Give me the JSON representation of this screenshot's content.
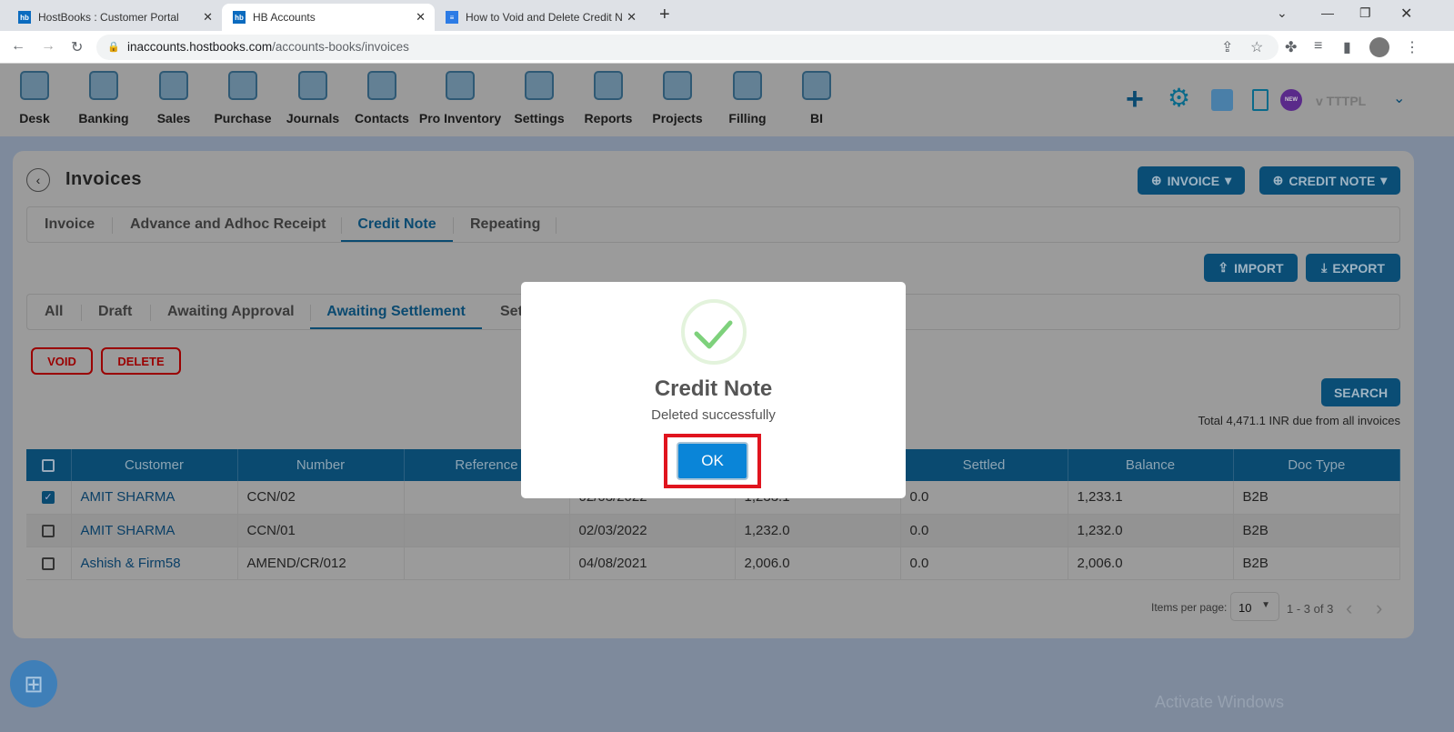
{
  "browser": {
    "tabs": [
      {
        "label": "HostBooks : Customer Portal",
        "favicon": "hb"
      },
      {
        "label": "HB Accounts",
        "favicon": "hb",
        "active": true
      },
      {
        "label": "How to Void and Delete Credit N",
        "favicon": "doc"
      }
    ],
    "url_host": "inaccounts.hostbooks.com",
    "url_path": "/accounts-books/invoices"
  },
  "nav": {
    "items": [
      "Desk",
      "Banking",
      "Sales",
      "Purchase",
      "Journals",
      "Contacts",
      "Pro Inventory",
      "Settings",
      "Reports",
      "Projects",
      "Filling",
      "BI"
    ],
    "company": "v TTTPL",
    "new_badge": "NEW"
  },
  "page": {
    "title": "Invoices",
    "invoice_btn": "INVOICE",
    "credit_note_btn": "CREDIT NOTE",
    "tabs": [
      "Invoice",
      "Advance and Adhoc Receipt",
      "Credit Note",
      "Repeating"
    ],
    "import": "IMPORT",
    "export": "EXPORT",
    "status_tabs": [
      "All",
      "Draft",
      "Awaiting Approval",
      "Awaiting Settlement",
      "Settled"
    ],
    "void": "VOID",
    "delete": "DELETE",
    "search": "SEARCH",
    "total": "Total 4,471.1 INR due from all invoices"
  },
  "table": {
    "headers": [
      "Customer",
      "Number",
      "Reference",
      "",
      "",
      "Settled",
      "Balance",
      "Doc Type"
    ],
    "rows": [
      {
        "checked": true,
        "cells": [
          "AMIT SHARMA",
          "CCN/02",
          "",
          "02/03/2022",
          "1,233.1",
          "0.0",
          "1,233.1",
          "B2B"
        ]
      },
      {
        "checked": false,
        "cells": [
          "AMIT SHARMA",
          "CCN/01",
          "",
          "02/03/2022",
          "1,232.0",
          "0.0",
          "1,232.0",
          "B2B"
        ]
      },
      {
        "checked": false,
        "cells": [
          "Ashish & Firm58",
          "AMEND/CR/012",
          "",
          "04/08/2021",
          "2,006.0",
          "0.0",
          "2,006.0",
          "B2B"
        ]
      }
    ]
  },
  "pagination": {
    "label": "Items per page:",
    "per_page": "10",
    "range": "1 - 3 of 3"
  },
  "modal": {
    "title": "Credit Note",
    "message": "Deleted successfully",
    "ok": "OK"
  },
  "watermark": "Activate Windows"
}
